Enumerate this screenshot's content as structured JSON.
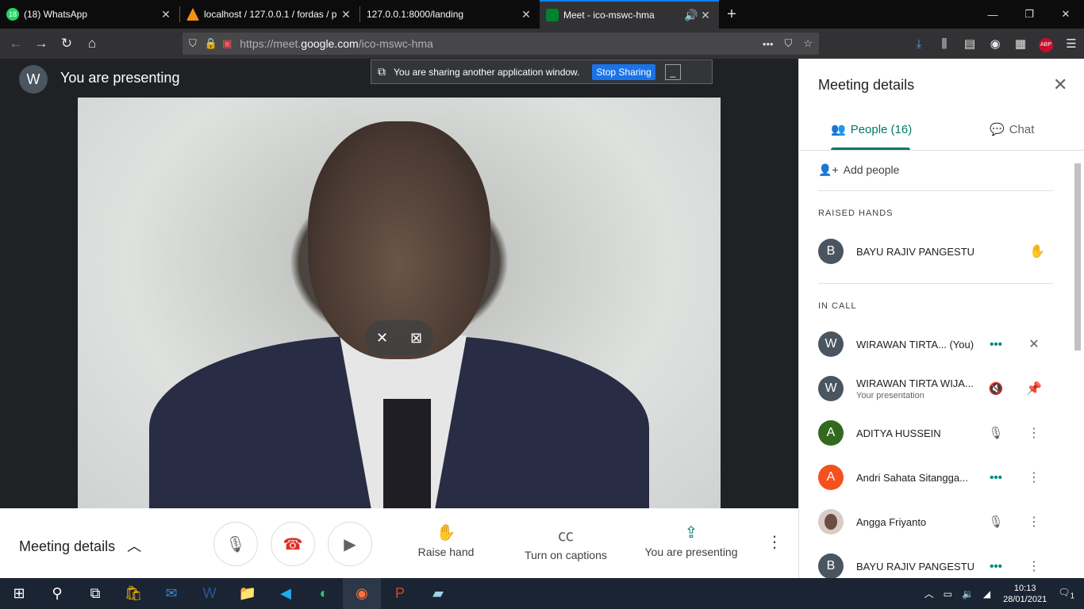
{
  "browser": {
    "tabs": [
      {
        "title": "(18) WhatsApp",
        "badge": "18",
        "fav_color": "#25d366"
      },
      {
        "title": "localhost / 127.0.0.1 / fordas / p",
        "fav_color": "#f29111"
      },
      {
        "title": "127.0.0.1:8000/landing",
        "fav_color": ""
      },
      {
        "title": "Meet - ico-mswc-hma",
        "fav_color": "#00832d",
        "active": true
      }
    ],
    "url_prefix": "https://meet.",
    "url_domain": "google.com",
    "url_path": "/ico-mswc-hma",
    "abp_label": "ABP"
  },
  "stage": {
    "presenter_initial": "W",
    "presenting_text": "You are presenting"
  },
  "share_bar": {
    "message": "You are sharing another application window.",
    "stop_label": "Stop Sharing"
  },
  "bottom": {
    "meeting_details": "Meeting details",
    "raise_hand": "Raise hand",
    "captions": "Turn on captions",
    "presenting": "You are presenting"
  },
  "panel": {
    "title": "Meeting details",
    "people_tab": "People (16)",
    "chat_tab": "Chat",
    "add_people": "Add people",
    "raised_hands_label": "RAISED HANDS",
    "in_call_label": "IN CALL",
    "raised": [
      {
        "initial": "B",
        "name": "BAYU RAJIV PANGESTU",
        "color": "#4a5560"
      }
    ],
    "participants": [
      {
        "initial": "W",
        "name": "WIRAWAN TIRTA... (You)",
        "sub": "",
        "color": "#4a5560"
      },
      {
        "initial": "W",
        "name": "WIRAWAN TIRTA WIJA...",
        "sub": "Your presentation",
        "color": "#4a5560"
      },
      {
        "initial": "A",
        "name": "ADITYA HUSSEIN",
        "sub": "",
        "color": "#33691e"
      },
      {
        "initial": "A",
        "name": "Andri Sahata Sitangga...",
        "sub": "",
        "color": "#f4511e"
      },
      {
        "initial": "",
        "name": "Angga Friyanto",
        "sub": "",
        "color": "#d7ccc8"
      },
      {
        "initial": "B",
        "name": "BAYU RAJIV PANGESTU",
        "sub": "",
        "color": "#4a5560"
      }
    ]
  },
  "taskbar": {
    "time": "10:13",
    "date": "28/01/2021",
    "notif_count": "1"
  }
}
